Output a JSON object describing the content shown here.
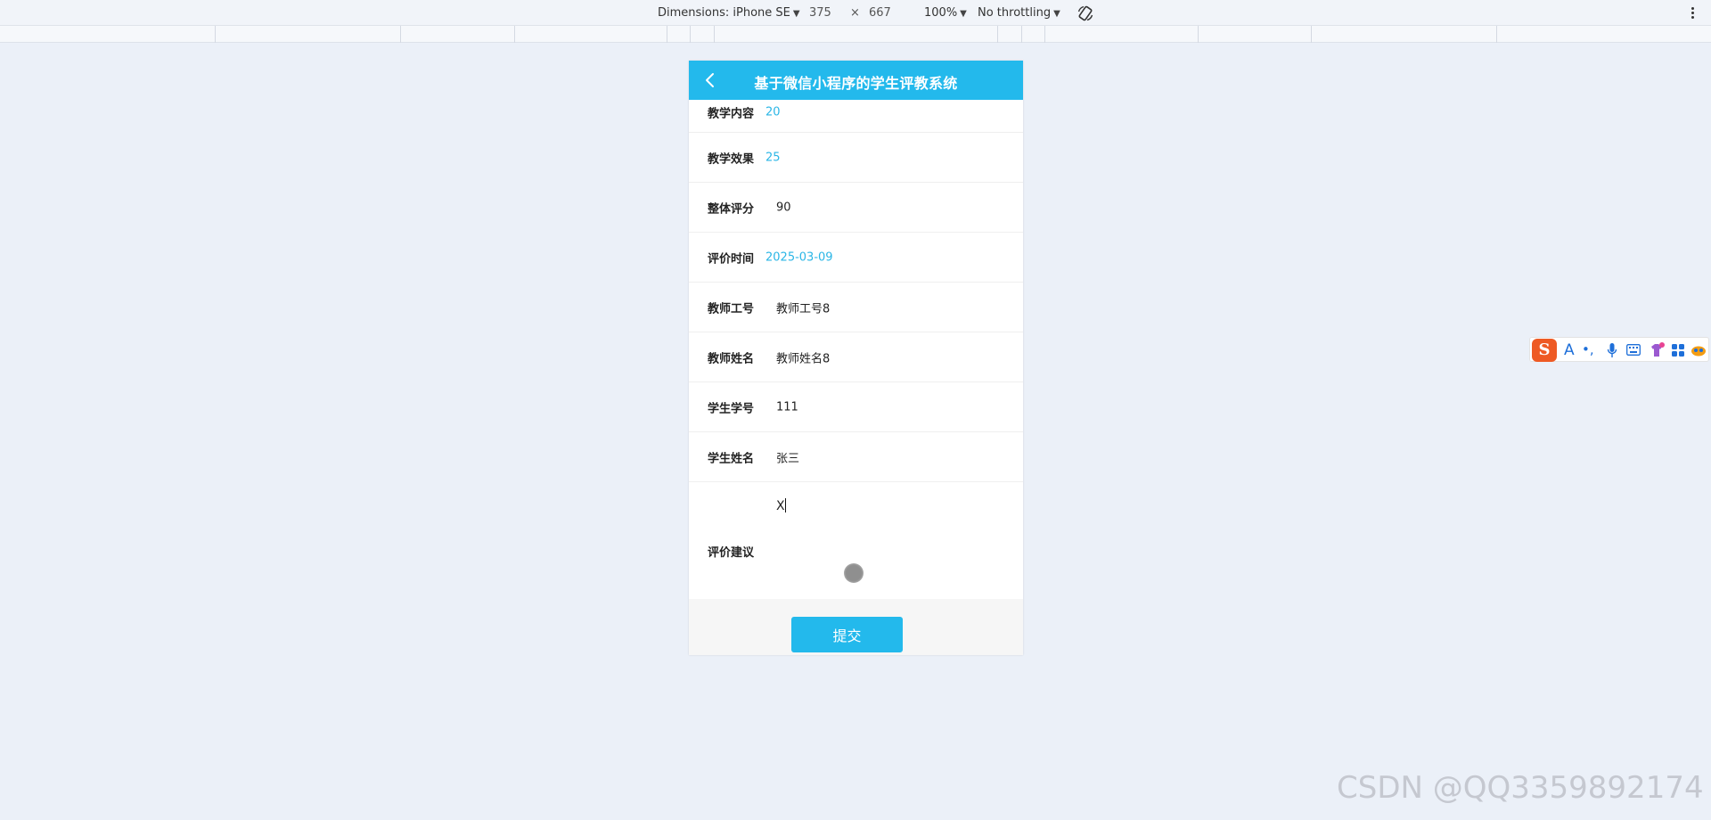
{
  "devtools": {
    "dimensions_label": "Dimensions: iPhone SE",
    "width": "375",
    "times": "×",
    "height": "667",
    "zoom": "100%",
    "throttling": "No throttling"
  },
  "app": {
    "title": "基于微信小程序的学生评教系统"
  },
  "form": {
    "rows": [
      {
        "label": "教学内容",
        "value": "20"
      },
      {
        "label": "教学效果",
        "value": "25"
      },
      {
        "label": "整体评分",
        "value": "90"
      },
      {
        "label": "评价时间",
        "value": "2025-03-09"
      },
      {
        "label": "教师工号",
        "value": "教师工号8"
      },
      {
        "label": "教师姓名",
        "value": "教师姓名8"
      },
      {
        "label": "学生学号",
        "value": "111"
      },
      {
        "label": "学生姓名",
        "value": "张三"
      }
    ],
    "suggestion": {
      "label": "评价建议",
      "value": "X"
    },
    "submit_label": "提交"
  },
  "ime": {
    "logo": "S",
    "items": [
      "A",
      "•,"
    ]
  },
  "watermark": "CSDN @QQ3359892174",
  "colors": {
    "accent": "#23b9ec",
    "value_blue": "#2bb6e6"
  }
}
